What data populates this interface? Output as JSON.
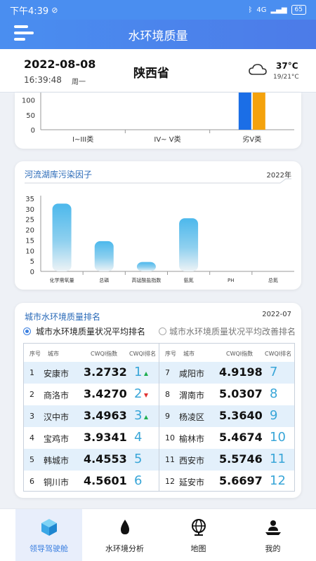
{
  "status_bar": {
    "time": "下午4:39",
    "network": "4G",
    "battery": "65"
  },
  "header": {
    "title": "水环境质量"
  },
  "info_bar": {
    "date": "2022-08-08",
    "time": "16:39:48",
    "weekday": "周一",
    "province": "陕西省",
    "temperature": "37°C",
    "temperature_range": "19/21°C"
  },
  "chart_data": [
    {
      "type": "bar",
      "categories": [
        "I~III类",
        "IV~ V类",
        "劣V类"
      ],
      "y_ticks": [
        "0",
        "50",
        "100"
      ],
      "series": [
        {
          "values": [
            0,
            0,
            115
          ],
          "color": "#1b6ee6"
        },
        {
          "values": [
            0,
            0,
            115
          ],
          "color": "#f4a20c"
        }
      ],
      "partially_scrolled": true,
      "grid": false
    },
    {
      "type": "bar",
      "title": "河流湖库污染因子",
      "year": "2022年",
      "categories": [
        "化学需氧量",
        "总磷",
        "高锰酸盐指数",
        "氨氮",
        "PH",
        "总氮"
      ],
      "values": [
        32.5,
        14.5,
        4.5,
        25.5,
        0,
        0
      ],
      "y_ticks": [
        "0",
        "5",
        "10",
        "15",
        "20",
        "25",
        "30",
        "35"
      ],
      "ylim": [
        0,
        35
      ],
      "bar_color": "#4cb8ec",
      "grid": false
    }
  ],
  "ranking": {
    "title": "城市水环境质量排名",
    "year": "2022-07",
    "options": [
      {
        "label": "城市水环境质量状况平均排名",
        "selected": true
      },
      {
        "label": "城市水环境质量状况平均改善排名",
        "selected": false
      }
    ],
    "columns": [
      "序号",
      "城市",
      "CWQI指数",
      "CWQI排名"
    ],
    "rows_left": [
      {
        "idx": "1",
        "city": "安康市",
        "value": "3.2732",
        "rank": "1",
        "trend": "up"
      },
      {
        "idx": "2",
        "city": "商洛市",
        "value": "3.4270",
        "rank": "2",
        "trend": "down"
      },
      {
        "idx": "3",
        "city": "汉中市",
        "value": "3.4963",
        "rank": "3",
        "trend": "up"
      },
      {
        "idx": "4",
        "city": "宝鸡市",
        "value": "3.9341",
        "rank": "4",
        "trend": ""
      },
      {
        "idx": "5",
        "city": "韩城市",
        "value": "4.4553",
        "rank": "5",
        "trend": ""
      },
      {
        "idx": "6",
        "city": "铜川市",
        "value": "4.5601",
        "rank": "6",
        "trend": ""
      }
    ],
    "rows_right": [
      {
        "idx": "7",
        "city": "咸阳市",
        "value": "4.9198",
        "rank": "7",
        "trend": ""
      },
      {
        "idx": "8",
        "city": "渭南市",
        "value": "5.0307",
        "rank": "8",
        "trend": ""
      },
      {
        "idx": "9",
        "city": "杨凌区",
        "value": "5.3640",
        "rank": "9",
        "trend": ""
      },
      {
        "idx": "10",
        "city": "榆林市",
        "value": "5.4674",
        "rank": "10",
        "trend": ""
      },
      {
        "idx": "11",
        "city": "西安市",
        "value": "5.5746",
        "rank": "11",
        "trend": ""
      },
      {
        "idx": "12",
        "city": "延安市",
        "value": "5.6697",
        "rank": "12",
        "trend": ""
      }
    ]
  },
  "tabs": [
    {
      "label": "领导驾驶舱",
      "icon": "cube-icon",
      "active": true
    },
    {
      "label": "水环境分析",
      "icon": "water-drop-icon",
      "active": false
    },
    {
      "label": "地图",
      "icon": "globe-icon",
      "active": false
    },
    {
      "label": "我的",
      "icon": "person-icon",
      "active": false
    }
  ],
  "colors": {
    "accent": "#3b7fe0",
    "header": "#4a8ef0",
    "rank": "#39a6d8",
    "up": "#1fae4f",
    "down": "#e03131"
  }
}
